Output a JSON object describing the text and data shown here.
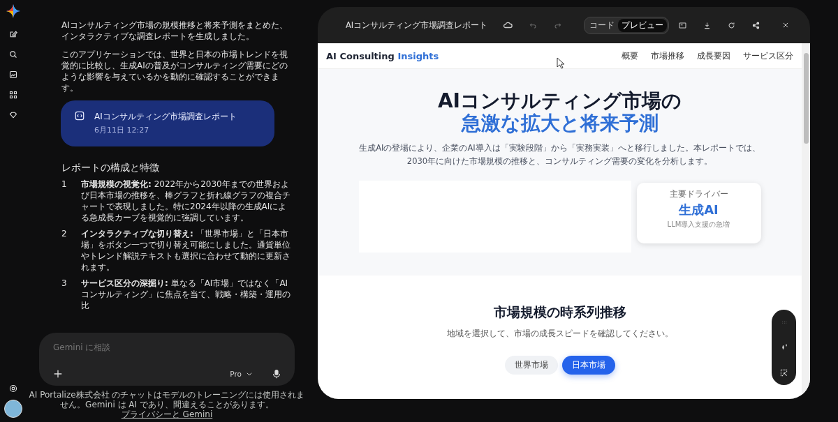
{
  "chat": {
    "paragraphs": [
      "AIコンサルティング市場の規模推移と将来予測をまとめた、インタラクティブな調査レポートを生成しました。",
      "このアプリケーションでは、世界と日本の市場トレンドを視覚的に比較し、生成AIの普及がコンサルティング需要にどのような影響を与えているかを動的に確認することができます。"
    ],
    "artifact": {
      "title": "AIコンサルティング市場調査レポート",
      "date": "6月11日 12:27"
    },
    "heading": "レポートの構成と特徴",
    "list": [
      {
        "number": "1",
        "title": "市場規模の視覚化:",
        "text": " 2022年から2030年までの世界および日本市場の推移を、棒グラフと折れ線グラフの複合チャートで表現しました。特に2024年以降の生成AIによる急成長カーブを視覚的に強調しています。"
      },
      {
        "number": "2",
        "title": "インタラクティブな切り替え:",
        "text": " 「世界市場」と「日本市場」をボタン一つで切り替え可能にしました。通貨単位やトレンド解説テキストも選択に合わせて動的に更新されます。"
      },
      {
        "number": "3",
        "title": "サービス区分の深掘り:",
        "text": " 単なる「AI市場」ではなく「AIコンサルティング」に焦点を当て、戦略・構築・運用の比"
      }
    ]
  },
  "composer": {
    "placeholder": "Gemini に相談",
    "model": "Pro"
  },
  "footer": {
    "text": "AI Portalize株式会社 のチャットはモデルのトレーニングには使用されません。Gemini は AI であり、間違えることがあります。",
    "link": "プライバシーと Gemini"
  },
  "preview": {
    "title": "AIコンサルティング市場調査レポート",
    "view_toggle": [
      {
        "label": "コード",
        "selected": false
      },
      {
        "label": "プレビュー",
        "selected": true
      }
    ],
    "site": {
      "brand": "AI Consulting",
      "brand_accent": "Insights",
      "nav": [
        "概要",
        "市場推移",
        "成長要因",
        "サービス区分"
      ],
      "hero": {
        "title_line1": "AIコンサルティング市場の",
        "title_line2": "急激な拡大と将来予測",
        "lead": "生成AIの登場により、企業のAI導入は「実験段階」から「実務実装」へと移行しました。本レポートでは、2030年に向けた市場規模の推移と、コンサルティング需要の変化を分析します。"
      },
      "driver": {
        "label": "主要ドライバー",
        "value": "生成AI",
        "note": "LLM導入支援の急増"
      },
      "section": {
        "title": "市場規模の時系列推移",
        "subtitle": "地域を選択して、市場の成長スピードを確認してください。",
        "regions": [
          {
            "label": "世界市場",
            "selected": false
          },
          {
            "label": "日本市場",
            "selected": true
          }
        ]
      }
    }
  }
}
